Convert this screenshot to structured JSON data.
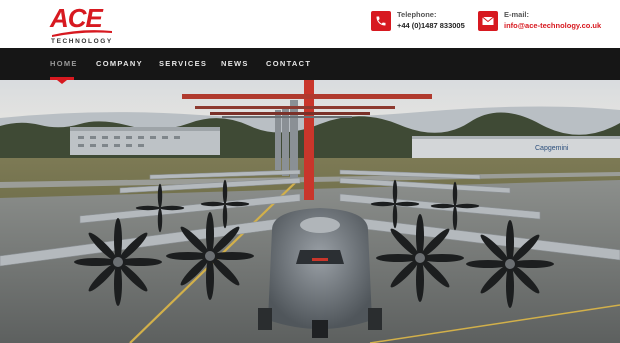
{
  "brand": {
    "name": "ACE",
    "tagline": "TECHNOLOGY",
    "accent_color": "#d71920"
  },
  "contact": {
    "phone_label": "Telephone:",
    "phone_value": "+44 (0)1487 833005",
    "phone_icon": "phone-icon",
    "email_label": "E-mail:",
    "email_value": "info@ace-technology.co.uk",
    "email_icon": "envelope-icon"
  },
  "nav": {
    "items": [
      {
        "label": "HOME",
        "active": true
      },
      {
        "label": "COMPANY",
        "active": false
      },
      {
        "label": "SERVICES",
        "active": false
      },
      {
        "label": "NEWS",
        "active": false
      },
      {
        "label": "CONTACT",
        "active": false
      }
    ],
    "background": "#161616"
  },
  "hero": {
    "image_alt": "Row of military transport aircraft lined up on a runway",
    "building_sign": "Capgemini"
  }
}
